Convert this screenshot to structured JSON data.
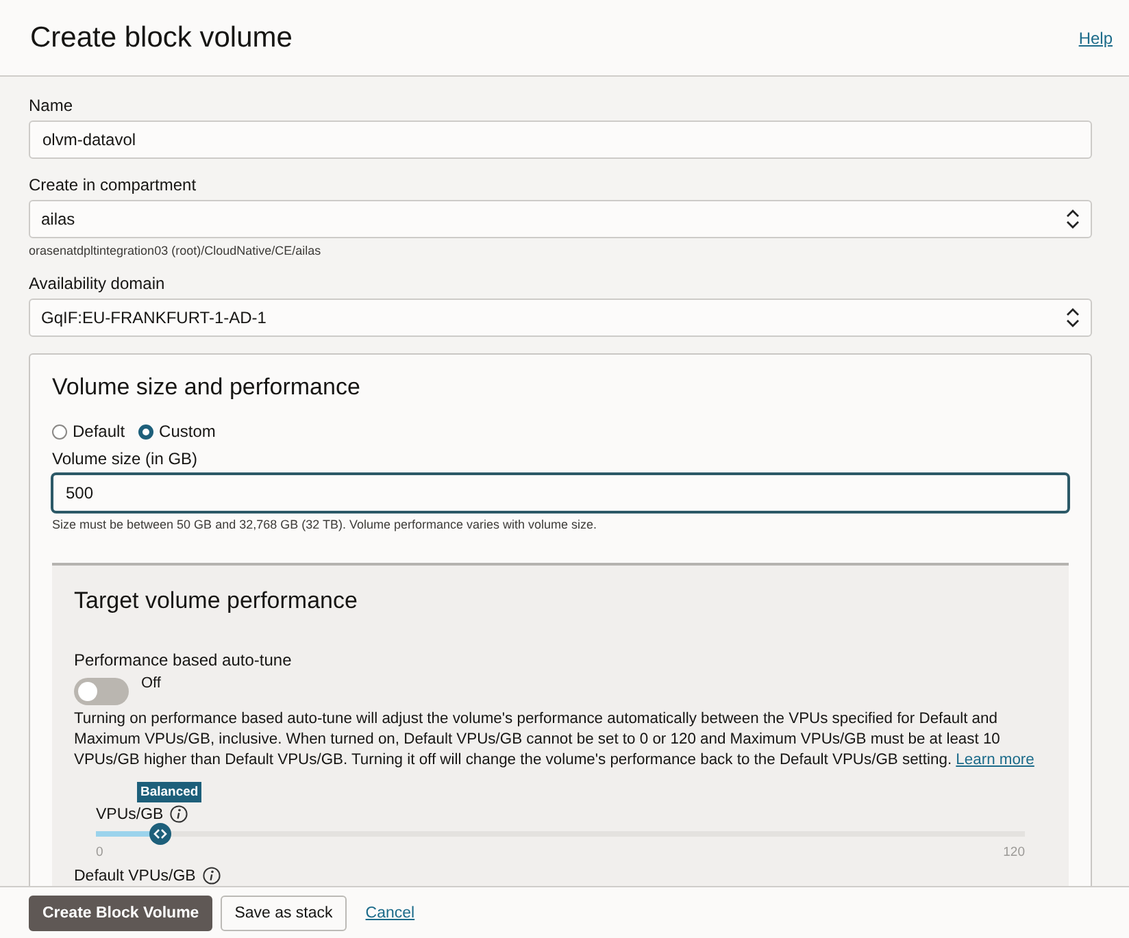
{
  "header": {
    "title": "Create block volume",
    "help_link": "Help"
  },
  "fields": [
    {
      "kind": "text",
      "label": "Name",
      "value": "olvm-datavol"
    },
    {
      "kind": "select",
      "label": "Create in compartment",
      "value": "ailas",
      "hint": "orasenatdpltintegration03 (root)/CloudNative/CE/ailas"
    },
    {
      "kind": "select",
      "label": "Availability domain",
      "value": "GqIF:EU-FRANKFURT-1-AD-1"
    }
  ],
  "volume_panel": {
    "title": "Volume size and performance",
    "options": [
      {
        "label": "Default",
        "selected": false
      },
      {
        "label": "Custom",
        "selected": true
      }
    ],
    "size_field": {
      "label": "Volume size (in GB)",
      "value": "500",
      "hint": "Size must be between 50 GB and 32,768 GB (32 TB). Volume performance varies with volume size."
    },
    "performance": {
      "title": "Target volume performance",
      "autotune": {
        "label": "Performance based auto-tune",
        "on": false,
        "state_text": "Off"
      },
      "description": "Turning on performance based auto-tune will adjust the volume's performance automatically between the VPUs specified for Default and Maximum VPUs/GB, inclusive. When turned on, Default VPUs/GB cannot be set to 0 or 120 and Maximum VPUs/GB must be at least 10 VPUs/GB higher than Default VPUs/GB. Turning it off will change the volume's performance back to the Default VPUs/GB setting.",
      "learn_more": "Learn more",
      "slider": {
        "badge": "Balanced",
        "label": "VPUs/GB",
        "level": 0.07,
        "min_label": "0",
        "max_label": "120"
      },
      "next_label": "Default VPUs/GB"
    }
  },
  "footer": {
    "buttons": [
      {
        "kind": "primary",
        "label": "Create Block Volume"
      },
      {
        "kind": "secondary",
        "label": "Save as stack"
      },
      {
        "kind": "link",
        "label": "Cancel"
      }
    ]
  }
}
